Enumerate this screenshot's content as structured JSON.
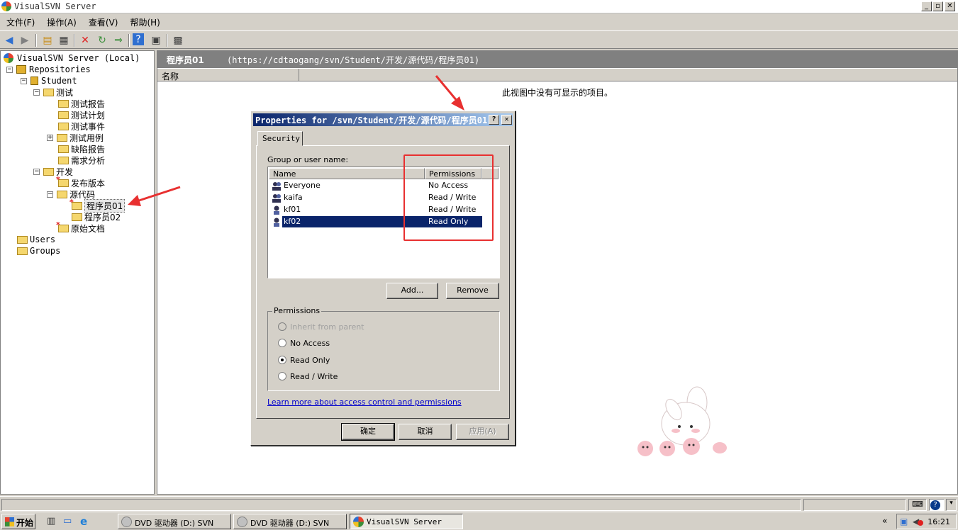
{
  "window": {
    "title": "VisualSVN Server",
    "minimize": "_",
    "maximize": "▫",
    "close": "✕"
  },
  "menu": [
    "文件(F)",
    "操作(A)",
    "查看(V)",
    "帮助(H)"
  ],
  "tree": {
    "root": "VisualSVN Server (Local)",
    "repositories": "Repositories",
    "student": "Student",
    "items": {
      "ceshi": "测试",
      "ceshi_baogao": "测试报告",
      "ceshi_jihua": "测试计划",
      "ceshi_shijian": "测试事件",
      "ceshi_yongli": "测试用例",
      "quexian_baogao": "缺陷报告",
      "xuqiu_fenxi": "需求分析",
      "kaifa": "开发",
      "fabu_banben": "发布版本",
      "yuandaima": "源代码",
      "chengxuyuan01": "程序员01",
      "chengxuyuan02": "程序员02",
      "yuanshi_wendang": "原始文档"
    },
    "users": "Users",
    "groups": "Groups"
  },
  "rightpane": {
    "title": "程序员01",
    "url": "(https://cdtaogang/svn/Student/开发/源代码/程序员01)",
    "column_name": "名称",
    "empty_message": "此视图中没有可显示的项目。"
  },
  "dialog": {
    "title": "Properties for /svn/Student/开发/源代码/程序员01",
    "help": "?",
    "close": "✕",
    "tab": "Security",
    "group_label": "Group or user name:",
    "columns": {
      "name": "Name",
      "permissions": "Permissions"
    },
    "rows": [
      {
        "name": "Everyone",
        "permission": "No Access"
      },
      {
        "name": "kaifa",
        "permission": "Read / Write"
      },
      {
        "name": "kf01",
        "permission": "Read / Write"
      },
      {
        "name": "kf02",
        "permission": "Read Only"
      }
    ],
    "add_button": "Add...",
    "remove_button": "Remove",
    "permissions_group": "Permissions",
    "radios": {
      "inherit": "Inherit from parent",
      "no_access": "No Access",
      "read_only": "Read Only",
      "read_write": "Read / Write"
    },
    "link": "Learn more about access control and permissions",
    "ok": "确定",
    "cancel": "取消",
    "apply": "应用(A)"
  },
  "taskbar": {
    "start": "开始",
    "tasks": [
      "DVD 驱动器 (D:) SVN",
      "DVD 驱动器 (D:) SVN",
      "VisualSVN Server"
    ],
    "clock": "16:21",
    "tray_arrow": "«"
  },
  "colors": {
    "selection": "#0a246a",
    "annotation": "#e83030",
    "header_gray": "#808080"
  }
}
